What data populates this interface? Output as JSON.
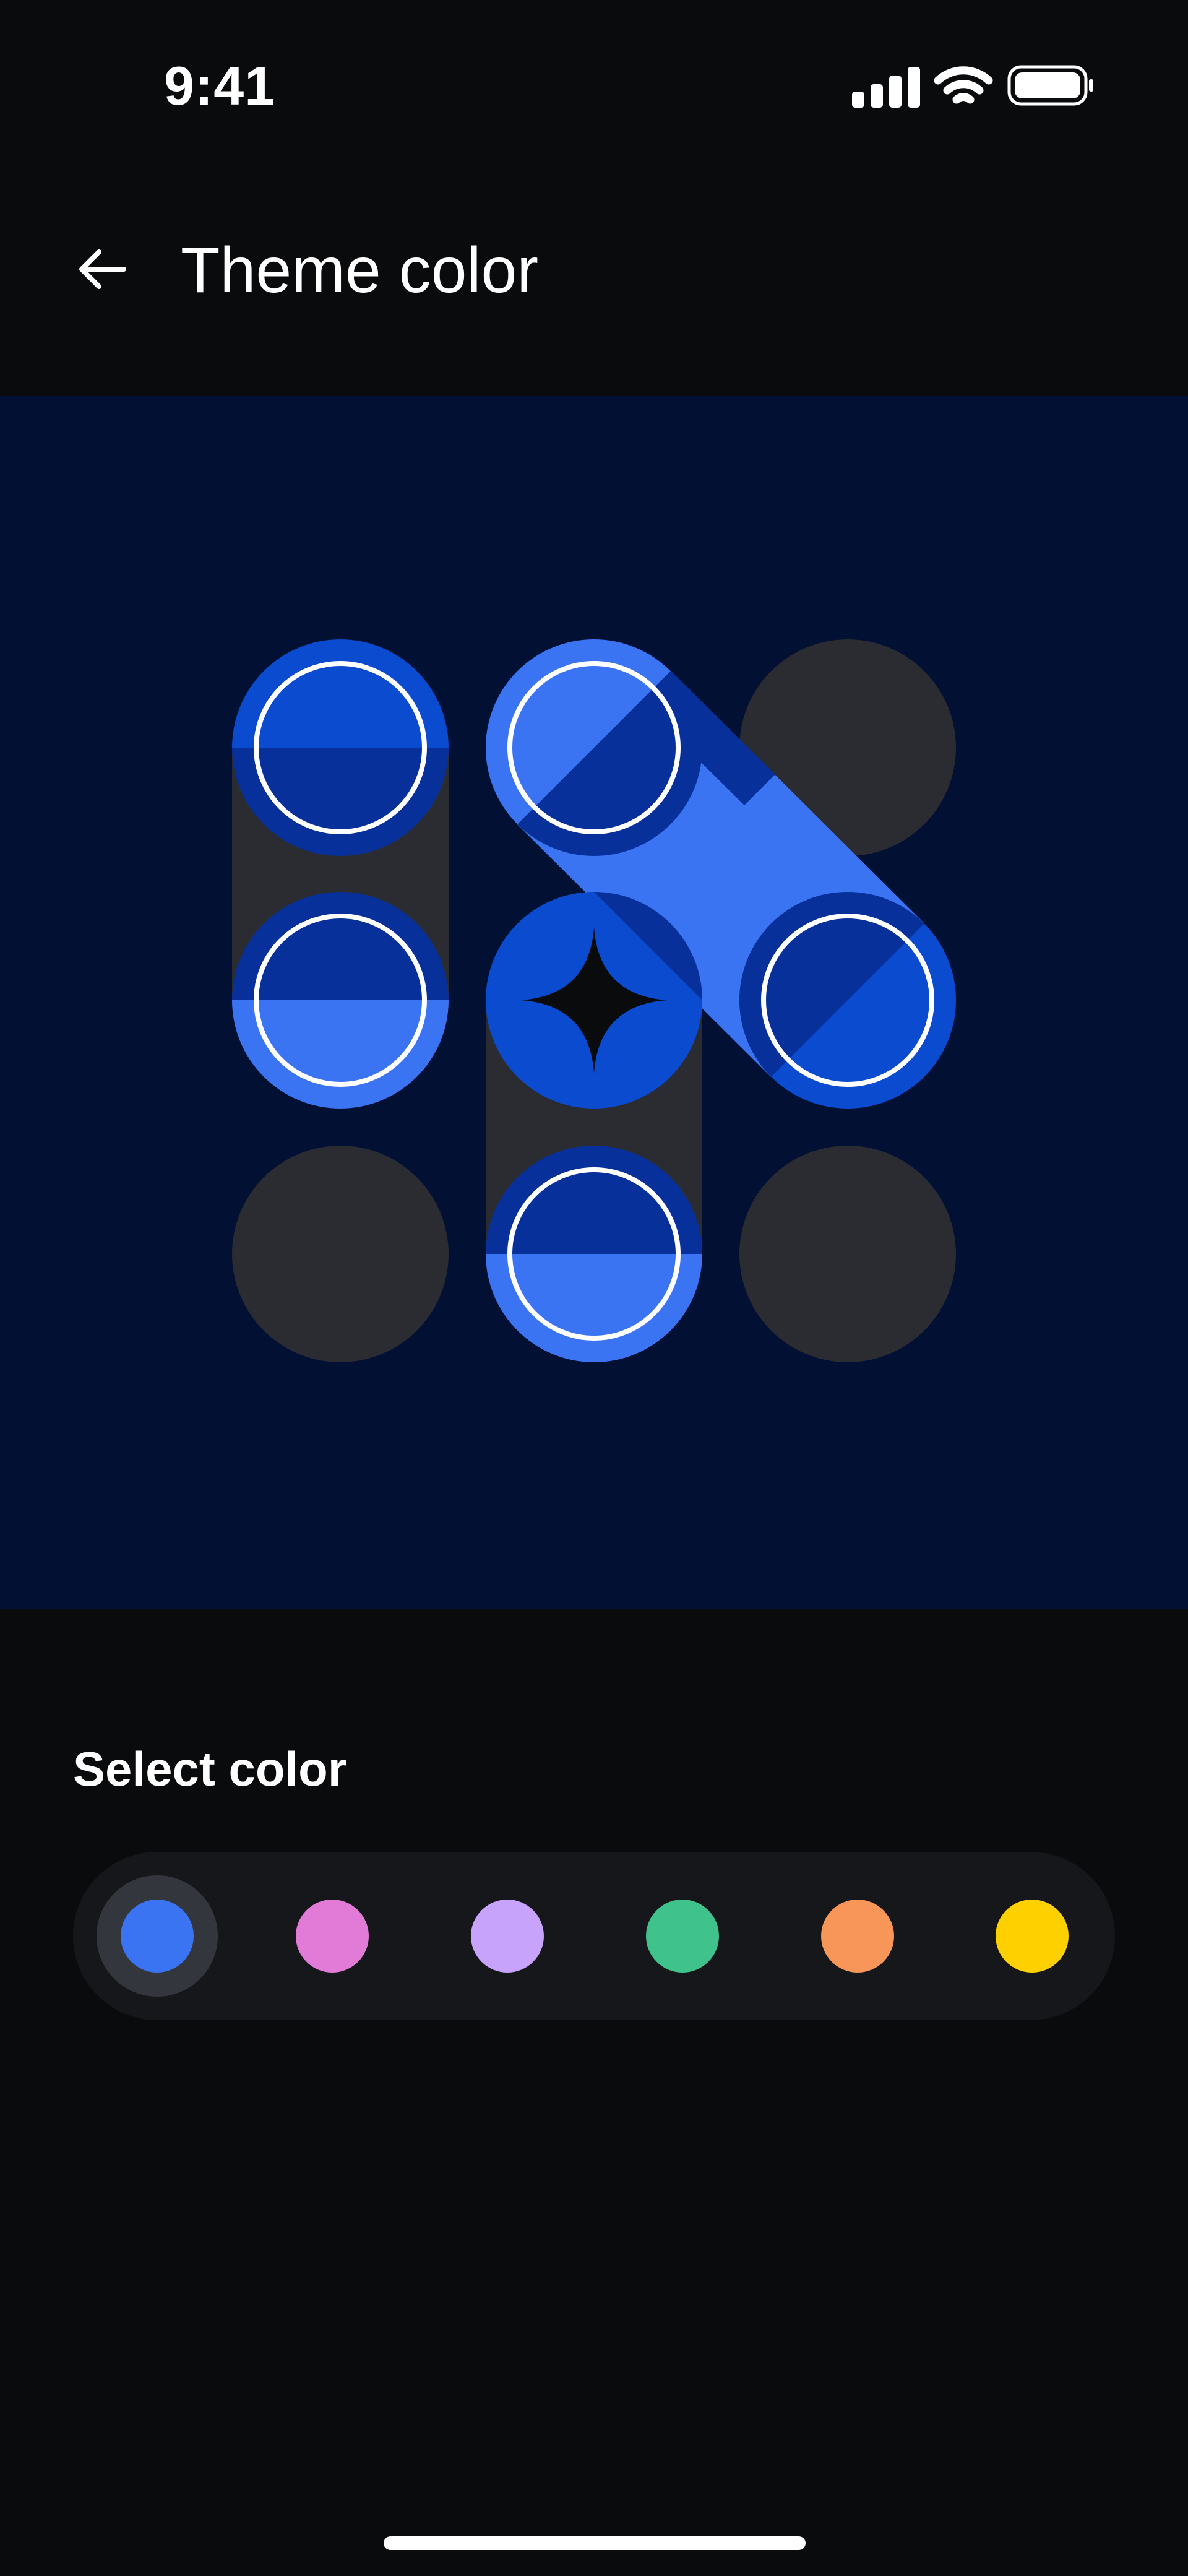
{
  "status_bar": {
    "time": "9:41",
    "icons": [
      "signal-icon",
      "wifi-icon",
      "battery-icon"
    ]
  },
  "header": {
    "back_icon": "arrow-left-icon",
    "title": "Theme color"
  },
  "preview": {
    "icon": "sparkle-icon",
    "colors": {
      "background": "#011033",
      "track": "#2a2c32",
      "empty": "#2a2c32",
      "light": "#3b74f2",
      "mid": "#0b4bd0",
      "dark": "#08309a",
      "ring": "#ffffff",
      "sparkle": "#0a0b0d"
    }
  },
  "color_picker": {
    "label": "Select color",
    "selected_index": 0,
    "options": [
      {
        "name": "blue",
        "color": "#3b74f2"
      },
      {
        "name": "pink",
        "color": "#e27bd8"
      },
      {
        "name": "lavender",
        "color": "#c8a3fb"
      },
      {
        "name": "green",
        "color": "#3fc28c"
      },
      {
        "name": "orange",
        "color": "#f79658"
      },
      {
        "name": "yellow",
        "color": "#ffd000"
      }
    ]
  }
}
